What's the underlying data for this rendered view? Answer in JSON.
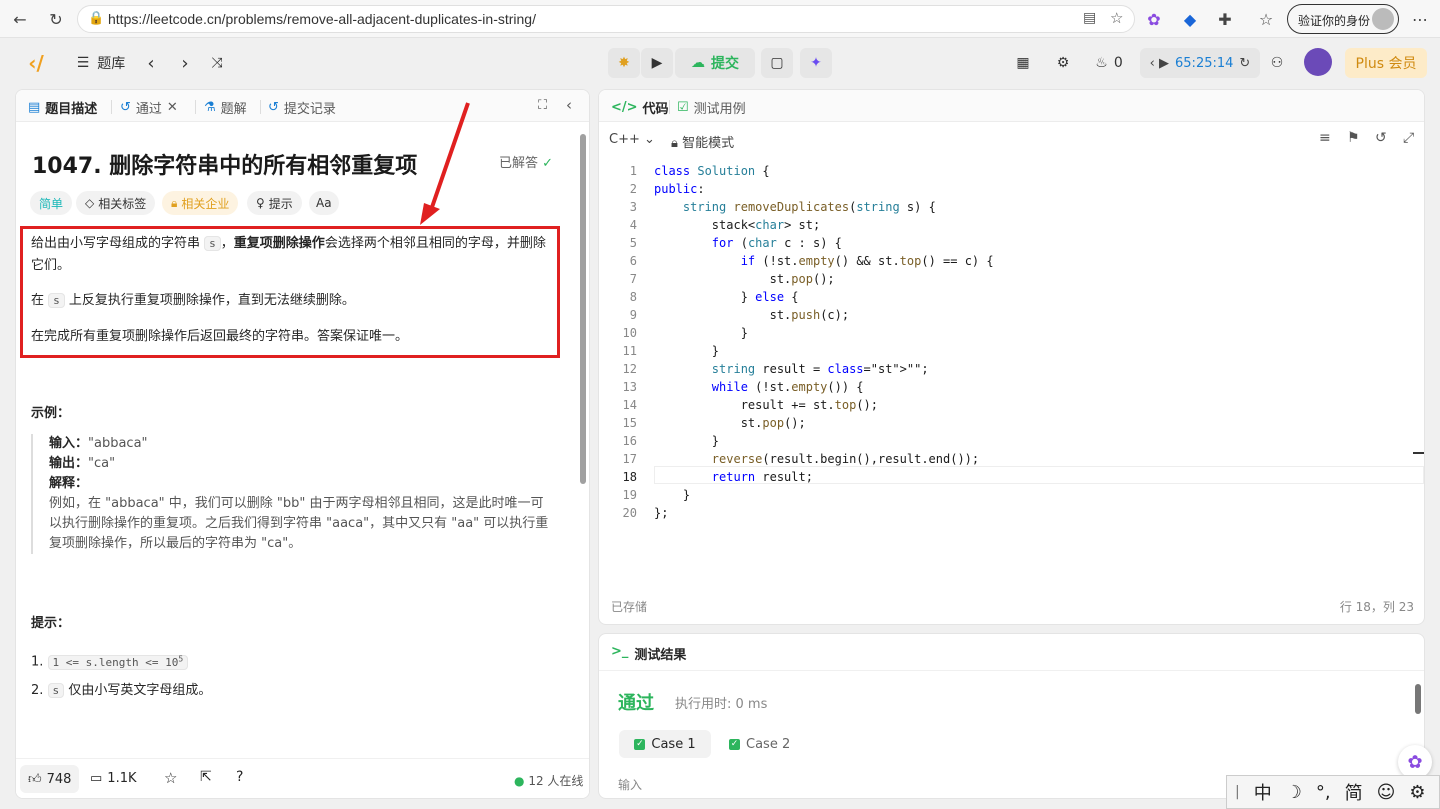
{
  "browser": {
    "url": "https://leetcode.cn/problems/remove-all-adjacent-duplicates-in-string/",
    "verify_label": "验证你的身份"
  },
  "topbar": {
    "problems_label": "题库",
    "submit_label": "提交",
    "streak_count": "0",
    "timer": "65:25:14",
    "plus_label": "Plus 会员"
  },
  "left": {
    "tabs": [
      "题目描述",
      "通过",
      "题解",
      "提交记录"
    ],
    "title": "1047. 删除字符串中的所有相邻重复项",
    "solved_label": "已解答",
    "chips": [
      "简单",
      "相关标签",
      "相关企业",
      "提示",
      "Aa"
    ],
    "desc": {
      "p1_a": "给出由小写字母组成的字符串",
      "p1_code": "s",
      "p1_sep": "，",
      "p1_bold": "重复项删除操作",
      "p1_b": "会选择两个相邻且相同的字母，并删除它们。",
      "p2_a": "在",
      "p2_code": "s",
      "p2_b": "上反复执行重复项删除操作，直到无法继续删除。",
      "p3": "在完成所有重复项删除操作后返回最终的字符串。答案保证唯一。"
    },
    "example_heading": "示例：",
    "example": {
      "input_label": "输入：",
      "input_value": "\"abbaca\"",
      "output_label": "输出：",
      "output_value": "\"ca\"",
      "explain_label": "解释：",
      "explain_text": "例如，在 \"abbaca\" 中，我们可以删除 \"bb\" 由于两字母相邻且相同，这是此时唯一可以执行删除操作的重复项。之后我们得到字符串 \"aaca\"，其中又只有 \"aa\" 可以执行重复项删除操作，所以最后的字符串为 \"ca\"。"
    },
    "hints_heading": "提示：",
    "hints": [
      {
        "num": "1.",
        "code": "1 <= s.length <= 10",
        "sup": "5",
        "text": ""
      },
      {
        "num": "2.",
        "code": "s",
        "sup": "",
        "text": "仅由小写英文字母组成。"
      }
    ],
    "footer": {
      "likes": "748",
      "comments": "1.1K",
      "online": "12 人在线"
    }
  },
  "editor": {
    "tabs": [
      "代码",
      "测试用例"
    ],
    "language": "C++",
    "mode": "智能模式",
    "lines": [
      "class Solution {",
      "public:",
      "    string removeDuplicates(string s) {",
      "        stack<char> st;",
      "        for (char c : s) {",
      "            if (!st.empty() && st.top() == c) {",
      "                st.pop();",
      "            } else {",
      "                st.push(c);",
      "            }",
      "        }",
      "        string result = \"\";",
      "        while (!st.empty()) {",
      "            result += st.top();",
      "            st.pop();",
      "        }",
      "        reverse(result.begin(),result.end());",
      "        return result;",
      "    }",
      "};"
    ],
    "line_numbers": [
      "1",
      "2",
      "3",
      "4",
      "5",
      "6",
      "7",
      "8",
      "9",
      "10",
      "11",
      "12",
      "13",
      "14",
      "15",
      "16",
      "17",
      "18",
      "19",
      "20"
    ],
    "saved_label": "已存储",
    "cursor_pos": "行 18，列 23"
  },
  "results": {
    "heading": "测试结果",
    "status": "通过",
    "runtime": "执行用时: 0 ms",
    "cases": [
      "Case 1",
      "Case 2"
    ],
    "input_label": "输入"
  },
  "ime": {
    "items": [
      "中",
      "☽",
      "°,",
      "简",
      "☺",
      "⚙"
    ]
  },
  "colors": {
    "accent_green": "#2db55d",
    "red_box": "#e02020",
    "timer_blue": "#1a7fd4",
    "plus_bg": "#fdebc8"
  }
}
